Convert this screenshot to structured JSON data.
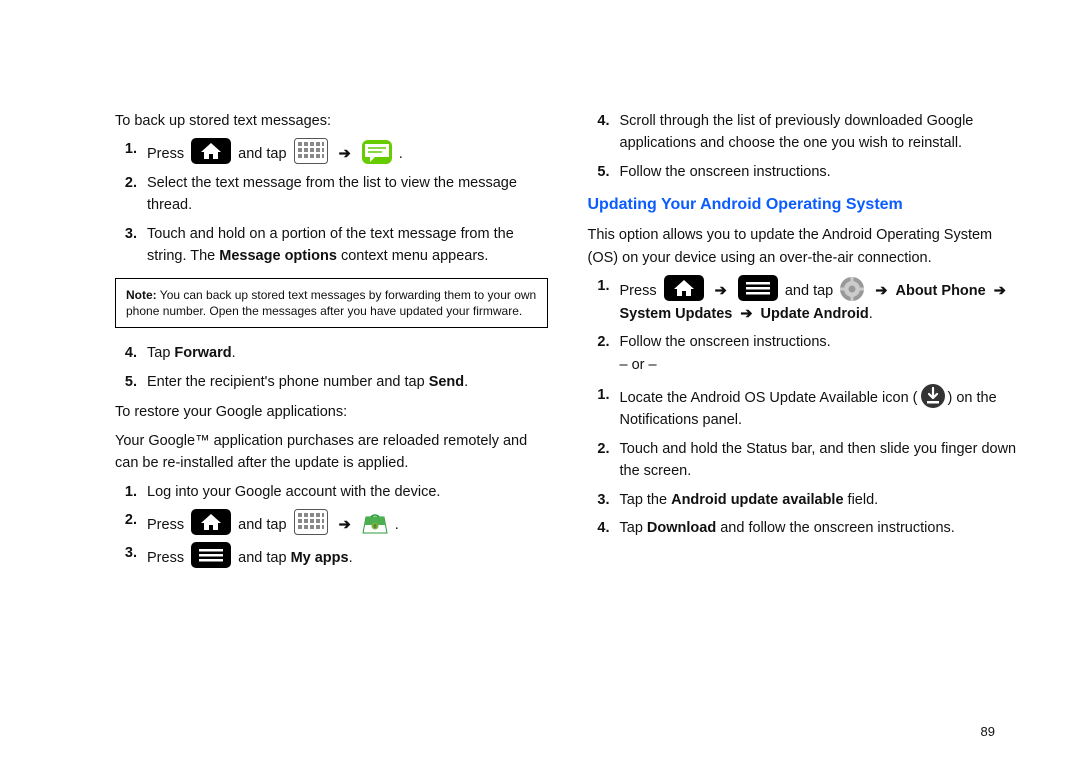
{
  "pageNumber": "89",
  "left": {
    "intro1": "To back up stored text messages:",
    "steps1": {
      "n1_press": "Press",
      "n1_andtap": "and tap",
      "n2": "Select the text message from the list to view the message thread.",
      "n3_a": "Touch and hold on a portion of the text message from the string. The ",
      "n3_bold": "Message options",
      "n3_b": " context menu appears."
    },
    "note_label": "Note:",
    "note_body": " You can back up stored text messages by forwarding them to your own phone number. Open the messages after you have updated your firmware.",
    "steps2": {
      "n4_a": "Tap ",
      "n4_bold": "Forward",
      "n4_b": ".",
      "n5_a": "Enter the recipient's phone number and tap ",
      "n5_bold": "Send",
      "n5_b": "."
    },
    "intro2": "To restore your Google applications:",
    "para2": "Your Google™ application purchases are reloaded remotely and can be re-installed after the update is applied.",
    "steps3": {
      "n1": "Log into your Google account with the device.",
      "n2_press": "Press",
      "n2_andtap": "and tap",
      "n3_press": "Press",
      "n3_andtap": "and tap ",
      "n3_bold": "My apps",
      "n3_b": "."
    }
  },
  "right": {
    "steps_cont": {
      "n4": "Scroll through the list of previously downloaded Google applications and choose the one you wish to reinstall.",
      "n5": "Follow the onscreen instructions."
    },
    "sectionTitle": "Updating Your Android Operating System",
    "para1": "This option allows you to update the Android Operating System (OS) on your device using an over-the-air connection.",
    "stepsA": {
      "n1_press": "Press",
      "n1_andtap": "and tap",
      "n1_bold1": "About Phone",
      "n1_bold2": "System Updates",
      "n1_bold3": "Update Android",
      "n2": "Follow the onscreen instructions.",
      "or": "– or –"
    },
    "stepsB": {
      "n1_a": "Locate the Android OS Update Available icon (",
      "n1_b": ") on the Notifications panel.",
      "n2": "Touch and hold the Status bar, and then slide you finger down the screen.",
      "n3_a": "Tap the ",
      "n3_bold": "Android update available",
      "n3_b": " field.",
      "n4_a": "Tap ",
      "n4_bold": "Download",
      "n4_b": " and follow the onscreen instructions."
    }
  },
  "icons": {
    "home": "home-icon",
    "apps": "apps-grid-icon",
    "messaging": "messaging-icon",
    "market_green": "market-bag-icon",
    "menu": "menu-lines-icon",
    "gear": "settings-gear-icon",
    "download": "download-icon"
  }
}
